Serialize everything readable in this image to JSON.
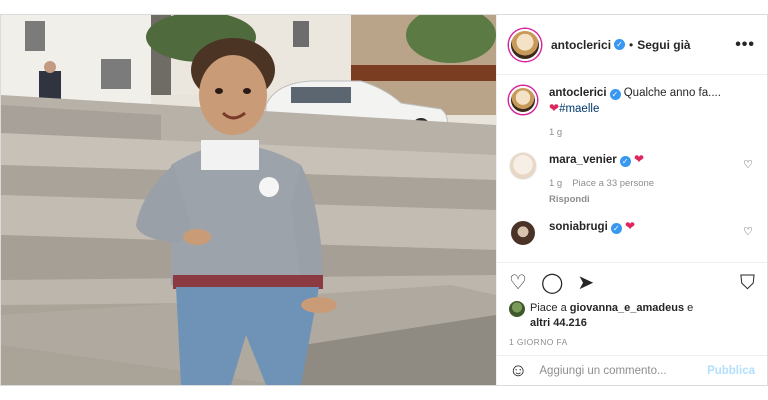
{
  "post": {
    "author": "antoclerici",
    "follow_separator": "•",
    "follow_status": "Segui già",
    "more_icon": "more-options-icon"
  },
  "caption": {
    "author": "antoclerici",
    "text": "Qualche anno fa....",
    "hashtag": "#maelle",
    "time": "1 g"
  },
  "comments": [
    {
      "author": "mara_venier",
      "text": "",
      "time": "1 g",
      "likes": "Piace a 33 persone",
      "reply": "Rispondi"
    },
    {
      "author": "soniabrugi",
      "text": ""
    }
  ],
  "actions": {
    "like_icon": "heart-icon",
    "comment_icon": "comment-icon",
    "share_icon": "share-icon",
    "save_icon": "bookmark-icon"
  },
  "likes": {
    "prefix": "Piace a",
    "user": "giovanna_e_amadeus",
    "connector": "e",
    "others": "altri 44.216"
  },
  "post_time": "1 GIORNO FA",
  "add_comment": {
    "placeholder": "Aggiungi un commento...",
    "publish": "Pubblica"
  },
  "colors": {
    "accent": "#3897f0",
    "heart": "#e0245e",
    "publish_disabled": "#b2dffc"
  }
}
